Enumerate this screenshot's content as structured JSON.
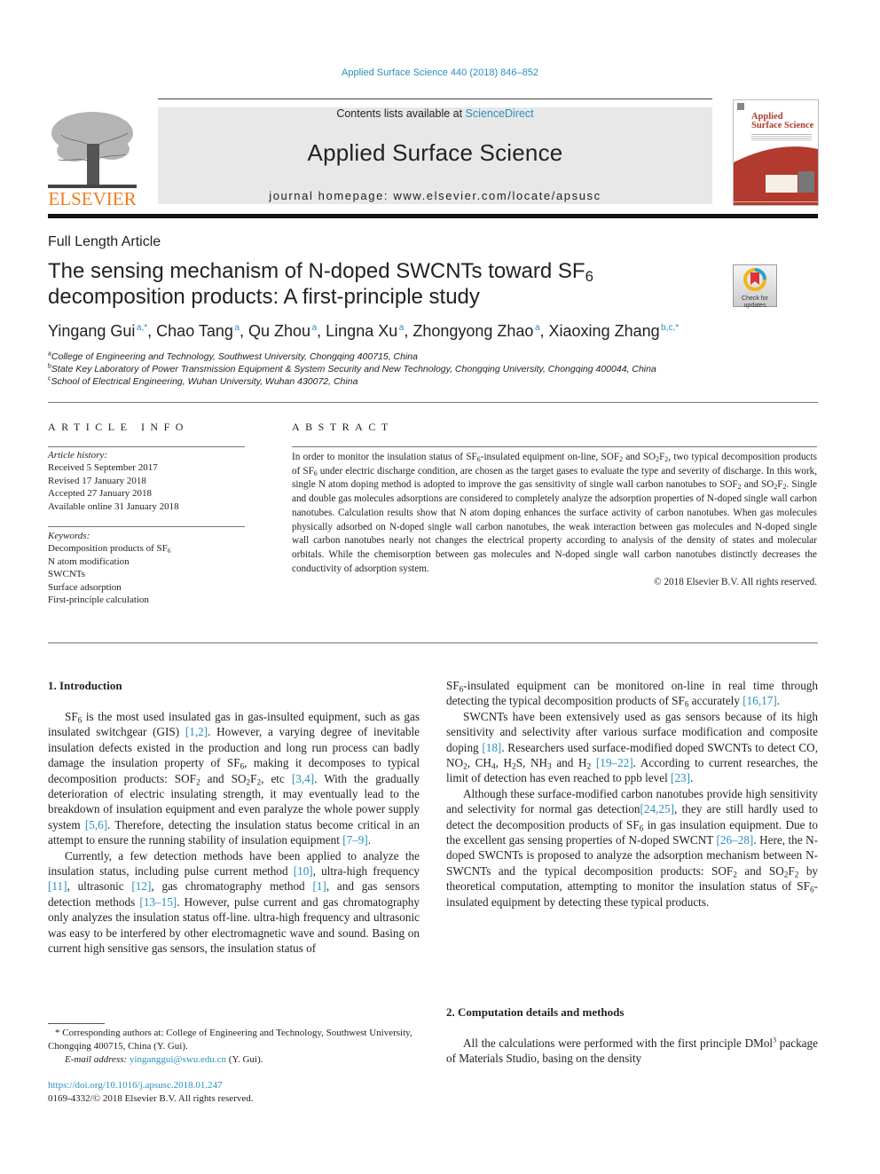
{
  "header": {
    "journal_ref": "Applied Surface Science 440 (2018) 846–852",
    "contents_prefix": "Contents lists available at ",
    "contents_link": "ScienceDirect",
    "journal_title": "Applied Surface Science",
    "homepage": "journal homepage: www.elsevier.com/locate/apsusc",
    "publisher_logo_text": "ELSEVIER",
    "cover_title_line1": "Applied",
    "cover_title_line2": "Surface Science",
    "check_updates_line1": "Check for",
    "check_updates_line2": "updates",
    "colors": {
      "link": "#2a8fbd",
      "elsevier_orange": "#f07d1b",
      "cover_red": "#b23a2e",
      "masthead_gray": "#e8e8e8"
    }
  },
  "article": {
    "type": "Full Length Article",
    "title_part1": "The sensing mechanism of N-doped SWCNTs toward SF",
    "title_sub": "6",
    "title_part2": " decomposition products: A first-principle study",
    "authors": [
      {
        "name": "Yingang Gui",
        "sup": "a,*"
      },
      {
        "name": "Chao Tang",
        "sup": "a"
      },
      {
        "name": "Qu Zhou",
        "sup": "a"
      },
      {
        "name": "Lingna Xu",
        "sup": "a"
      },
      {
        "name": "Zhongyong Zhao",
        "sup": "a"
      },
      {
        "name": "Xiaoxing Zhang",
        "sup": "b,c,*"
      }
    ],
    "affiliations": [
      {
        "key": "a",
        "text": "College of Engineering and Technology, Southwest University, Chongqing 400715, China"
      },
      {
        "key": "b",
        "text": "State Key Laboratory of Power Transmission Equipment & System Security and New Technology, Chongqing University, Chongqing 400044, China"
      },
      {
        "key": "c",
        "text": "School of Electrical Engineering, Wuhan University, Wuhan 430072, China"
      }
    ]
  },
  "article_info": {
    "heading": "ARTICLE INFO",
    "history_label": "Article history:",
    "history": [
      "Received 5 September 2017",
      "Revised 17 January 2018",
      "Accepted 27 January 2018",
      "Available online 31 January 2018"
    ],
    "keywords_label": "Keywords:",
    "keywords": [
      "Decomposition products of SF6",
      "N atom modification",
      "SWCNTs",
      "Surface adsorption",
      "First-principle calculation"
    ]
  },
  "abstract": {
    "heading": "ABSTRACT",
    "text": "In order to monitor the insulation status of SF6-insulated equipment on-line, SOF2 and SO2F2, two typical decomposition products of SF6 under electric discharge condition, are chosen as the target gases to evaluate the type and severity of discharge. In this work, single N atom doping method is adopted to improve the gas sensitivity of single wall carbon nanotubes to SOF2 and SO2F2. Single and double gas molecules adsorptions are considered to completely analyze the adsorption properties of N-doped single wall carbon nanotubes. Calculation results show that N atom doping enhances the surface activity of carbon nanotubes. When gas molecules physically adsorbed on N-doped single wall carbon nanotubes, the weak interaction between gas molecules and N-doped single wall carbon nanotubes nearly not changes the electrical property according to analysis of the density of states and molecular orbitals. While the chemisorption between gas molecules and N-doped single wall carbon nanotubes distinctly decreases the conductivity of adsorption system.",
    "copyright": "© 2018 Elsevier B.V. All rights reserved."
  },
  "body": {
    "section1_heading": "1. Introduction",
    "section2_heading": "2. Computation details and methods",
    "references": {
      "r1_2": "[1,2]",
      "r3_4": "[3,4]",
      "r5_6": "[5,6]",
      "r7_9": "[7–9]",
      "r10": "[10]",
      "r11": "[11]",
      "r12": "[12]",
      "r1": "[1]",
      "r13_15": "[13–15]",
      "r16_17": "[16,17]",
      "r18": "[18]",
      "r19_22": "[19–22]",
      "r23": "[23]",
      "r24_25": "[24,25]",
      "r26_28": "[26–28]"
    }
  },
  "footer": {
    "corresponding": "* Corresponding authors at: College of Engineering and Technology, Southwest University, Chongqing 400715, China (Y. Gui).",
    "email_label": "E-mail address: ",
    "email": "yinganggui@swu.edu.cn",
    "email_suffix": " (Y. Gui).",
    "doi": "https://doi.org/10.1016/j.apsusc.2018.01.247",
    "issn": "0169-4332/© 2018 Elsevier B.V. All rights reserved."
  }
}
